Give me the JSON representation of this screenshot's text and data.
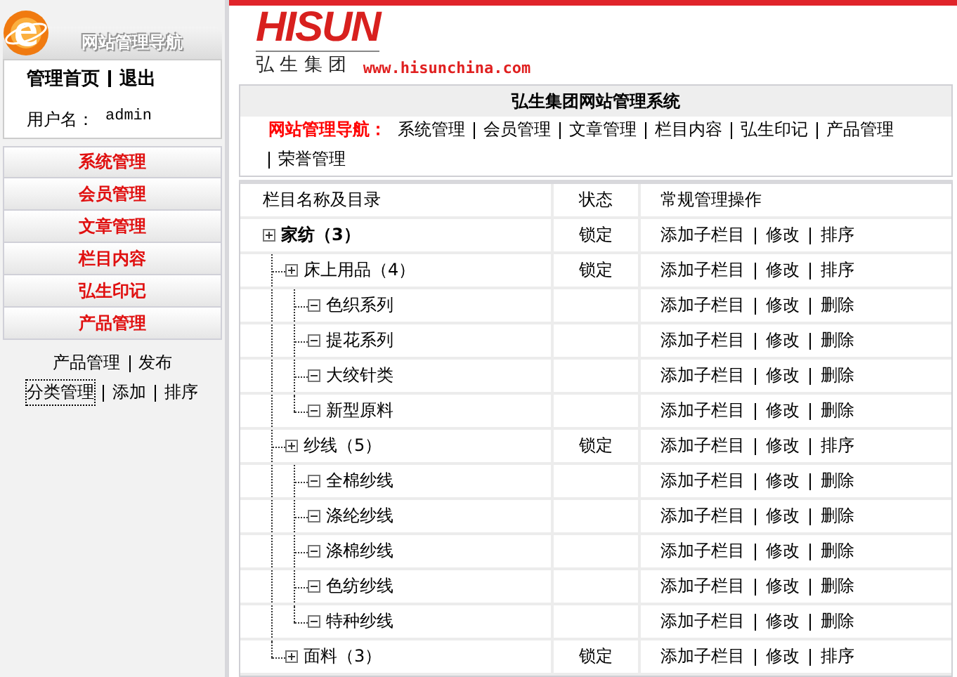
{
  "sidebar": {
    "title": "网站管理导航",
    "user_links": [
      "管理首页",
      "退出"
    ],
    "user_label": "用户名：",
    "user_name": "admin",
    "menu": [
      {
        "label": "系统管理"
      },
      {
        "label": "会员管理"
      },
      {
        "label": "文章管理"
      },
      {
        "label": "栏目内容"
      },
      {
        "label": "弘生印记"
      },
      {
        "label": "产品管理"
      }
    ],
    "submenu": [
      [
        {
          "label": "产品管理",
          "focused": false
        },
        {
          "label": "发布",
          "focused": false
        }
      ],
      [
        {
          "label": "分类管理",
          "focused": true
        },
        {
          "label": "添加",
          "focused": false
        },
        {
          "label": "排序",
          "focused": false
        }
      ]
    ]
  },
  "header": {
    "logo": "HISUN",
    "company": "弘 生 集 团",
    "url": "www.hisunchina.com"
  },
  "panel": {
    "title": "弘生集团网站管理系统",
    "nav_label": "网站管理导航：",
    "nav_links": [
      "系统管理",
      "会员管理",
      "文章管理",
      "栏目内容",
      "弘生印记",
      "产品管理",
      "荣誉管理"
    ]
  },
  "table": {
    "columns": [
      "栏目名称及目录",
      "状态",
      "常规管理操作"
    ],
    "tree": [
      {
        "name": "家纺（3）",
        "status": "锁定",
        "actions": [
          "添加子栏目",
          "修改",
          "排序"
        ],
        "children": [
          {
            "name": "床上用品（4）",
            "status": "锁定",
            "actions": [
              "添加子栏目",
              "修改",
              "排序"
            ],
            "children": [
              {
                "name": "色织系列",
                "actions": [
                  "添加子栏目",
                  "修改",
                  "删除"
                ]
              },
              {
                "name": "提花系列",
                "actions": [
                  "添加子栏目",
                  "修改",
                  "删除"
                ]
              },
              {
                "name": "大绞针类",
                "actions": [
                  "添加子栏目",
                  "修改",
                  "删除"
                ]
              },
              {
                "name": "新型原料",
                "actions": [
                  "添加子栏目",
                  "修改",
                  "删除"
                ]
              }
            ]
          },
          {
            "name": "纱线（5）",
            "status": "锁定",
            "actions": [
              "添加子栏目",
              "修改",
              "排序"
            ],
            "children": [
              {
                "name": "全棉纱线",
                "actions": [
                  "添加子栏目",
                  "修改",
                  "删除"
                ]
              },
              {
                "name": "涤纶纱线",
                "actions": [
                  "添加子栏目",
                  "修改",
                  "删除"
                ]
              },
              {
                "name": "涤棉纱线",
                "actions": [
                  "添加子栏目",
                  "修改",
                  "删除"
                ]
              },
              {
                "name": "色纺纱线",
                "actions": [
                  "添加子栏目",
                  "修改",
                  "删除"
                ]
              },
              {
                "name": "特种纱线",
                "actions": [
                  "添加子栏目",
                  "修改",
                  "删除"
                ]
              }
            ]
          },
          {
            "name": "面料（3）",
            "status": "锁定",
            "has_children": true,
            "actions": [
              "添加子栏目",
              "修改",
              "排序"
            ]
          }
        ]
      }
    ]
  }
}
